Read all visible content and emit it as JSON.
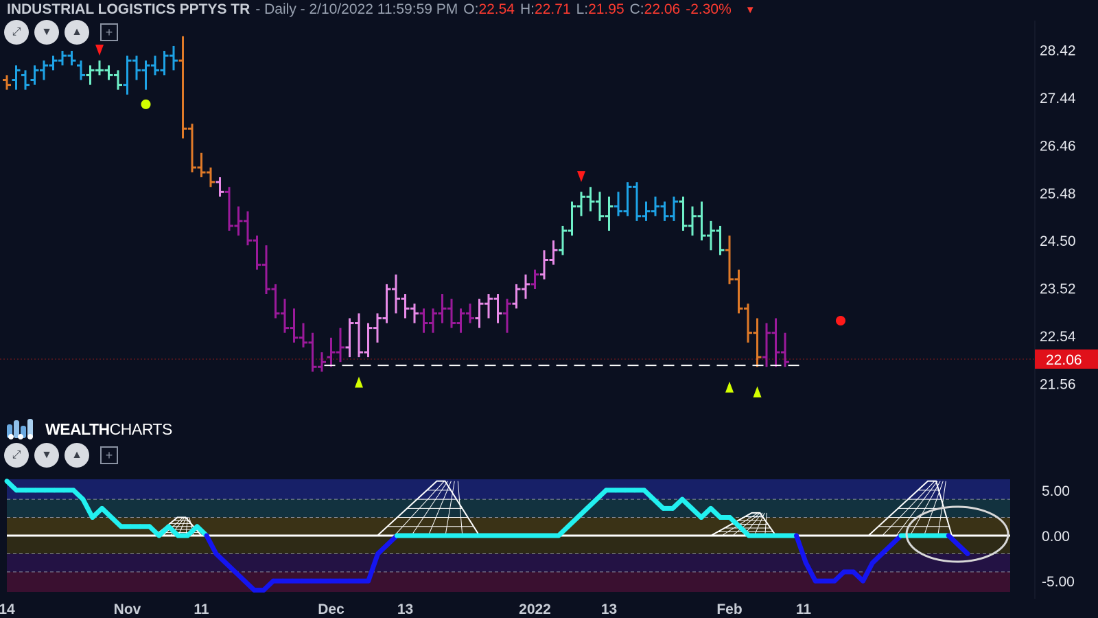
{
  "header": {
    "symbol": "INDUSTRIAL LOGISTICS PPTYS TR",
    "info": "- Daily - 2/10/2022 11:59:59 PM",
    "o_label": "O:",
    "o_value": "22.54",
    "h_label": "H:",
    "h_value": "22.71",
    "l_label": "L:",
    "l_value": "21.95",
    "c_label": "C:",
    "c_value": "22.06",
    "change": "-2.30%",
    "change_arrow": "▼"
  },
  "toolbar_icons": [
    "expand-icon",
    "collapse-icon",
    "chevron-down-icon",
    "chevron-up-icon",
    "add-icon"
  ],
  "logo": {
    "brand_bold": "WEALTH",
    "brand_light": "CHARTS"
  },
  "last_price_label": "22.06",
  "colors": {
    "background": "#0b1020",
    "strong_bull": "#1ea3e6",
    "weak_bull": "#6ff0c8",
    "weak_bear": "#e88be8",
    "strong_bear": "#9b1a9b",
    "neutral_orange": "#e07a28",
    "oscillator_up": "#22f0f0",
    "oscillator_down": "#1515f0",
    "price_label": "#e0101a",
    "signal_green": "#d4ff00",
    "signal_red": "#ff1a1a"
  },
  "chart_data": [
    {
      "type": "bar",
      "name": "price",
      "x_labels": [
        {
          "label": "14",
          "bar": 0
        },
        {
          "label": "Nov",
          "bar": 13
        },
        {
          "label": "11",
          "bar": 21
        },
        {
          "label": "Dec",
          "bar": 35
        },
        {
          "label": "13",
          "bar": 43
        },
        {
          "label": "2022",
          "bar": 57
        },
        {
          "label": "13",
          "bar": 65
        },
        {
          "label": "Feb",
          "bar": 78
        },
        {
          "label": "11",
          "bar": 86
        }
      ],
      "ylim": [
        21.0,
        29.05
      ],
      "yticks": [
        "28.42",
        "27.44",
        "26.46",
        "25.48",
        "24.50",
        "23.52",
        "22.54",
        "21.56"
      ],
      "last_price": 22.06,
      "support_level": 21.93,
      "ohlc": [
        [
          27.8,
          27.9,
          27.6,
          27.7,
          "neutral_orange"
        ],
        [
          27.8,
          28.1,
          27.6,
          28.0,
          "strong_bull"
        ],
        [
          27.9,
          28.0,
          27.6,
          27.7,
          "strong_bull"
        ],
        [
          27.8,
          28.1,
          27.7,
          28.0,
          "strong_bull"
        ],
        [
          28.0,
          28.2,
          27.8,
          28.1,
          "strong_bull"
        ],
        [
          28.1,
          28.3,
          28.0,
          28.2,
          "strong_bull"
        ],
        [
          28.2,
          28.4,
          28.1,
          28.3,
          "strong_bull"
        ],
        [
          28.3,
          28.4,
          28.1,
          28.2,
          "strong_bull"
        ],
        [
          28.1,
          28.2,
          27.8,
          27.9,
          "strong_bull"
        ],
        [
          27.9,
          28.1,
          27.7,
          28.0,
          "weak_bull"
        ],
        [
          28.0,
          28.2,
          27.9,
          28.0,
          "weak_bull"
        ],
        [
          28.0,
          28.1,
          27.8,
          27.9,
          "weak_bull"
        ],
        [
          27.9,
          28.0,
          27.6,
          27.7,
          "weak_bull"
        ],
        [
          27.7,
          28.3,
          27.5,
          28.2,
          "strong_bull"
        ],
        [
          28.2,
          28.3,
          27.8,
          28.0,
          "strong_bull"
        ],
        [
          28.0,
          28.2,
          27.6,
          28.1,
          "strong_bull"
        ],
        [
          28.1,
          28.3,
          27.9,
          28.0,
          "strong_bull"
        ],
        [
          28.0,
          28.4,
          27.9,
          28.3,
          "strong_bull"
        ],
        [
          28.3,
          28.5,
          28.0,
          28.2,
          "strong_bull"
        ],
        [
          28.2,
          28.7,
          26.6,
          26.8,
          "neutral_orange"
        ],
        [
          26.8,
          26.9,
          25.9,
          26.0,
          "neutral_orange"
        ],
        [
          26.0,
          26.3,
          25.8,
          25.9,
          "neutral_orange"
        ],
        [
          25.9,
          26.0,
          25.6,
          25.7,
          "neutral_orange"
        ],
        [
          25.7,
          25.8,
          25.4,
          25.5,
          "weak_bear"
        ],
        [
          25.5,
          25.6,
          24.7,
          24.8,
          "strong_bear"
        ],
        [
          24.8,
          25.2,
          24.6,
          24.9,
          "strong_bear"
        ],
        [
          24.9,
          25.1,
          24.4,
          24.5,
          "strong_bear"
        ],
        [
          24.5,
          24.6,
          23.9,
          24.0,
          "strong_bear"
        ],
        [
          24.0,
          24.4,
          23.4,
          23.5,
          "strong_bear"
        ],
        [
          23.5,
          23.6,
          22.9,
          23.0,
          "strong_bear"
        ],
        [
          23.0,
          23.3,
          22.6,
          22.7,
          "strong_bear"
        ],
        [
          22.7,
          23.1,
          22.4,
          22.5,
          "strong_bear"
        ],
        [
          22.5,
          22.8,
          22.3,
          22.4,
          "strong_bear"
        ],
        [
          22.4,
          22.6,
          21.8,
          21.9,
          "strong_bear"
        ],
        [
          21.9,
          22.2,
          21.8,
          22.0,
          "strong_bear"
        ],
        [
          22.1,
          22.5,
          21.9,
          22.2,
          "strong_bear"
        ],
        [
          22.2,
          22.7,
          22.0,
          22.3,
          "strong_bear"
        ],
        [
          22.3,
          22.9,
          22.1,
          22.8,
          "weak_bear"
        ],
        [
          22.8,
          23.0,
          22.1,
          22.2,
          "weak_bear"
        ],
        [
          22.2,
          22.8,
          22.1,
          22.7,
          "weak_bear"
        ],
        [
          22.7,
          23.0,
          22.4,
          22.9,
          "weak_bear"
        ],
        [
          22.9,
          23.6,
          22.8,
          23.5,
          "weak_bear"
        ],
        [
          23.5,
          23.8,
          23.0,
          23.3,
          "weak_bear"
        ],
        [
          23.3,
          23.4,
          22.9,
          23.1,
          "weak_bear"
        ],
        [
          23.1,
          23.2,
          22.8,
          23.0,
          "weak_bear"
        ],
        [
          23.0,
          23.1,
          22.6,
          22.8,
          "strong_bear"
        ],
        [
          22.8,
          23.1,
          22.6,
          23.0,
          "strong_bear"
        ],
        [
          23.0,
          23.4,
          22.8,
          23.1,
          "strong_bear"
        ],
        [
          23.1,
          23.3,
          22.7,
          22.8,
          "strong_bear"
        ],
        [
          22.8,
          23.1,
          22.6,
          23.0,
          "strong_bear"
        ],
        [
          23.0,
          23.2,
          22.8,
          22.9,
          "strong_bear"
        ],
        [
          22.9,
          23.3,
          22.7,
          23.2,
          "weak_bear"
        ],
        [
          23.2,
          23.4,
          22.9,
          23.3,
          "weak_bear"
        ],
        [
          23.3,
          23.4,
          22.8,
          23.0,
          "weak_bear"
        ],
        [
          23.0,
          23.3,
          22.6,
          23.2,
          "strong_bear"
        ],
        [
          23.2,
          23.6,
          23.1,
          23.5,
          "weak_bear"
        ],
        [
          23.5,
          23.8,
          23.3,
          23.6,
          "weak_bear"
        ],
        [
          23.6,
          23.9,
          23.5,
          23.8,
          "strong_bear"
        ],
        [
          23.8,
          24.3,
          23.7,
          24.1,
          "weak_bear"
        ],
        [
          24.1,
          24.5,
          24.0,
          24.3,
          "weak_bear"
        ],
        [
          24.3,
          24.8,
          24.2,
          24.7,
          "weak_bull"
        ],
        [
          24.7,
          25.3,
          24.6,
          25.2,
          "weak_bull"
        ],
        [
          25.2,
          25.5,
          25.0,
          25.4,
          "weak_bull"
        ],
        [
          25.4,
          25.6,
          25.1,
          25.3,
          "weak_bull"
        ],
        [
          25.3,
          25.5,
          24.9,
          25.0,
          "weak_bull"
        ],
        [
          25.0,
          25.4,
          24.7,
          25.2,
          "weak_bull"
        ],
        [
          25.2,
          25.5,
          25.0,
          25.1,
          "strong_bull"
        ],
        [
          25.1,
          25.7,
          25.0,
          25.6,
          "strong_bull"
        ],
        [
          25.6,
          25.7,
          24.9,
          25.0,
          "strong_bull"
        ],
        [
          25.0,
          25.3,
          24.9,
          25.1,
          "strong_bull"
        ],
        [
          25.1,
          25.4,
          25.0,
          25.2,
          "strong_bull"
        ],
        [
          25.2,
          25.3,
          24.9,
          25.0,
          "strong_bull"
        ],
        [
          25.0,
          25.4,
          24.9,
          25.3,
          "strong_bull"
        ],
        [
          25.3,
          25.4,
          24.7,
          24.8,
          "weak_bull"
        ],
        [
          24.8,
          25.2,
          24.6,
          25.0,
          "weak_bull"
        ],
        [
          25.0,
          25.3,
          24.5,
          24.6,
          "weak_bull"
        ],
        [
          24.6,
          24.9,
          24.3,
          24.7,
          "weak_bull"
        ],
        [
          24.7,
          24.8,
          24.2,
          24.3,
          "weak_bull"
        ],
        [
          24.3,
          24.6,
          23.6,
          23.7,
          "neutral_orange"
        ],
        [
          23.7,
          23.9,
          23.0,
          23.1,
          "neutral_orange"
        ],
        [
          23.1,
          23.2,
          22.4,
          22.6,
          "neutral_orange"
        ],
        [
          22.6,
          22.9,
          21.9,
          22.1,
          "neutral_orange"
        ],
        [
          22.1,
          22.8,
          21.9,
          22.6,
          "strong_bear"
        ],
        [
          22.6,
          22.9,
          21.9,
          22.2,
          "strong_bear"
        ],
        [
          22.2,
          22.6,
          21.9,
          22.0,
          "strong_bear"
        ]
      ],
      "signals": [
        {
          "bar": 10,
          "type": "sell-triangle",
          "price": 28.4
        },
        {
          "bar": 15,
          "type": "dot-green",
          "price": 27.3
        },
        {
          "bar": 38,
          "type": "buy-triangle",
          "price": 21.6
        },
        {
          "bar": 62,
          "type": "sell-triangle",
          "price": 25.8
        },
        {
          "bar": 78,
          "type": "buy-triangle",
          "price": 21.5
        },
        {
          "bar": 81,
          "type": "buy-triangle",
          "price": 21.4
        },
        {
          "bar": 90,
          "type": "dot-red",
          "price": 22.85
        }
      ]
    },
    {
      "type": "line",
      "name": "oscillator",
      "ylim": [
        -6.2,
        6.2
      ],
      "yticks": [
        "5.00",
        "0.00",
        "-5.00"
      ],
      "values": [
        6,
        5,
        5,
        5,
        5,
        5,
        5,
        5,
        4,
        2,
        3,
        2,
        1,
        1,
        1,
        1,
        0,
        1,
        0,
        0,
        1,
        0,
        -2,
        -3,
        -4,
        -5,
        -6,
        -6,
        -5,
        -5,
        -5,
        -5,
        -5,
        -5,
        -5,
        -5,
        -5,
        -5,
        -5,
        -2,
        -1,
        0,
        0,
        0,
        0,
        0,
        0,
        0,
        0,
        0,
        0,
        0,
        0,
        0,
        0,
        0,
        0,
        0,
        0,
        1,
        2,
        3,
        4,
        5,
        5,
        5,
        5,
        5,
        4,
        3,
        3,
        4,
        3,
        2,
        3,
        2,
        2,
        1,
        0,
        0,
        0,
        0,
        0,
        0,
        -3,
        -5,
        -5,
        -5,
        -4,
        -4,
        -5,
        -3,
        -2,
        -1,
        0,
        0,
        0,
        0,
        0,
        0,
        -1,
        -2
      ],
      "waves": [
        {
          "start": 16,
          "peak": 19,
          "end": 21,
          "height": 2
        },
        {
          "start": 40,
          "peak": 47,
          "end": 51,
          "height": 6
        },
        {
          "start": 76,
          "peak": 81,
          "end": 83,
          "height": 2.5
        },
        {
          "start": 93,
          "peak": 100,
          "end": 102,
          "height": 6
        }
      ]
    }
  ]
}
